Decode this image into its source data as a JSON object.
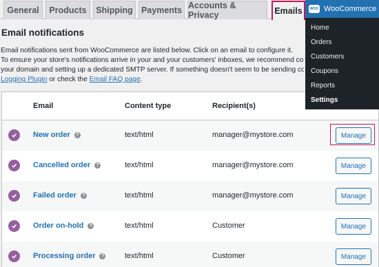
{
  "tabs": [
    {
      "label": "General"
    },
    {
      "label": "Products"
    },
    {
      "label": "Shipping"
    },
    {
      "label": "Payments"
    },
    {
      "label": "Accounts & Privacy"
    },
    {
      "label": "Emails",
      "active": true
    }
  ],
  "section": {
    "title": "Email notifications",
    "intro_line1": "Email notifications sent from WooCommerce are listed below. Click on an email to configure it.",
    "intro_line2": "To ensure your store's notifications arrive in your and your customers' inboxes, we recommend co",
    "intro_line3": "your domain and setting up a dedicated SMTP server. If something doesn't seem to be sending cor",
    "intro_link1": "Logging Plugin",
    "intro_mid": " or check the ",
    "intro_link2": "Email FAQ page",
    "intro_end": "."
  },
  "table": {
    "headers": {
      "email": "Email",
      "content_type": "Content type",
      "recipients": "Recipient(s)"
    },
    "rows": [
      {
        "name": "New order",
        "content_type": "text/html",
        "recipient": "manager@mystore.com",
        "action": "Manage",
        "enabled": true
      },
      {
        "name": "Cancelled order",
        "content_type": "text/html",
        "recipient": "manager@mystore.com",
        "action": "Manage",
        "enabled": true
      },
      {
        "name": "Failed order",
        "content_type": "text/html",
        "recipient": "manager@mystore.com",
        "action": "Manage",
        "enabled": true
      },
      {
        "name": "Order on-hold",
        "content_type": "text/html",
        "recipient": "Customer",
        "action": "Manage",
        "enabled": true
      },
      {
        "name": "Processing order",
        "content_type": "text/html",
        "recipient": "Customer",
        "action": "Manage",
        "enabled": true
      }
    ]
  },
  "flyout": {
    "title": "WooCommerce",
    "logo_text": "WOO",
    "items": [
      {
        "label": "Home"
      },
      {
        "label": "Orders"
      },
      {
        "label": "Customers"
      },
      {
        "label": "Coupons"
      },
      {
        "label": "Reports"
      },
      {
        "label": "Settings",
        "current": true
      }
    ]
  },
  "colors": {
    "accent": "#2271b1",
    "check": "#955fa0",
    "highlight": "#c2185b",
    "admin_bar": "#1d2327"
  }
}
